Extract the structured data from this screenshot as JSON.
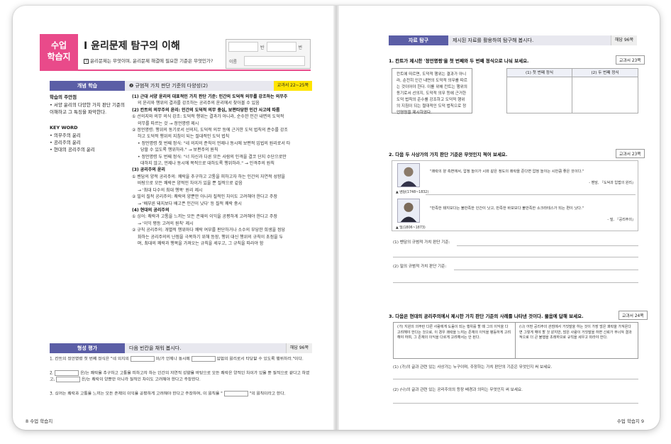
{
  "left": {
    "badge_line1": "수업",
    "badge_line2": "학습지",
    "unit_title": "Ⅰ  윤리문제 탐구의 이해",
    "unit_sub": "윤리문제는 무엇이며, 윤리문제 해결에 필요한 기준은 무엇인가?",
    "name_box": {
      "class_label": "반",
      "number_label": "번",
      "name_label": "이름"
    },
    "concept_bar": {
      "label": "개념 학습",
      "desc": "❷ 규범적 가치 판단 기준의 다양성(2)",
      "tag": "교과서 22~25쪽"
    },
    "sidebar": {
      "goal_heading": "학습의 주안점",
      "goal_text": "• 서양 윤리의 다양한 가치 판단 기준의 이해하고 그 특징을 파악한다.",
      "kw_heading": "KEY WORD",
      "keywords": [
        "의무주의 윤리",
        "공리주의 윤리",
        "현대의 공리주의 윤리"
      ]
    },
    "content": [
      {
        "cls": "h",
        "t": "(1) 근대 서양 윤리의 대표적인 가치 판단 기준: 인간의 도덕적 의무를 강조하는 의무주"
      },
      {
        "cls": "ind",
        "t": "의 윤리와 행위의 결과를 강조하는 공리주의 윤리에서 찾아볼 수 있음"
      },
      {
        "cls": "h",
        "t": "(2) 칸트의 의무주의 윤리: 인간의 도덕적 의무 중심, 보편타당한 인간 사고에 따름"
      },
      {
        "cls": "",
        "t": "① 선의지와 의무 의식 강조: 도덕적 행위는 결과가 아니라, 순수한 인간 내면의 도덕적"
      },
      {
        "cls": "ind",
        "t": "의무를 따르는 것 → 정언명령 제시"
      },
      {
        "cls": "",
        "t": "② 정언명령: 행위의 동기로서 선의지, 도덕적 의무 등에 근거한 도덕 법칙의 준수를 강조"
      },
      {
        "cls": "ind",
        "t": "하고 도덕적 행위의 지침이 되는 절대적인 도덕 법칙"
      },
      {
        "cls": "ind",
        "t": "• 정언명령 첫 번째 정식: \"네 의지의 준칙이 언제나 동시에 보편적 입법의 원리로서 타"
      },
      {
        "cls": "ind2",
        "t": "당할 수 있도록 행위하라.\" → 보편주의 원칙"
      },
      {
        "cls": "ind",
        "t": "• 정언명령 두 번째 정식: \"너 자신과 다른 모든 사람의 인격을 결코 단지 수단으로만"
      },
      {
        "cls": "ind2",
        "t": "대하지 않고, 언제나 동시에 목적으로 대하도록 행위하라.\" → 인격주의 원칙"
      },
      {
        "cls": "h",
        "t": "(3) 공리주의 윤리"
      },
      {
        "cls": "",
        "t": "① 벤담의 양적 공리주의: 쾌락을 추구하고 고통을 피하고자 하는 인간의 자연적 성향을"
      },
      {
        "cls": "ind",
        "t": "바탕으로 모든 쾌락은 양적인 차이가 있을 뿐 질적으로 같음"
      },
      {
        "cls": "ind",
        "t": "→ '최대 다수의 최대 행복' 원리 제시"
      },
      {
        "cls": "",
        "t": "② 밀의 질적 공리주의: 쾌락의 양뿐만 아니라 질적인 차이도 고려해야 한다고 주장"
      },
      {
        "cls": "ind",
        "t": "→ '배부른 돼지보다 배고픈 인간이 낫다' 등 질적 쾌락 중시"
      },
      {
        "cls": "h",
        "t": "(4) 현대의 공리주의"
      },
      {
        "cls": "",
        "t": "① 싱어: 쾌락과 고통을 느끼는 모든 존재의 이익을 공평하게 고려해야 한다고 주장"
      },
      {
        "cls": "ind",
        "t": "→ '이익 평등 고려의 원칙' 제시"
      },
      {
        "cls": "",
        "t": "② 규칙 공리주의: 개별적 행위마다 쾌락 여부를 판단하거나 소수의 부당한 희생을 정당"
      },
      {
        "cls": "ind",
        "t": "화하는 공리주의의 난점을 극복하기 위해 등장, 행위 대신 행위의 규칙이 초점을 두"
      },
      {
        "cls": "ind",
        "t": "며, 최대의 쾌락과 행복을 가져오는 규칙을 세우고, 그 규칙을 따라야 함"
      }
    ],
    "eval_bar": {
      "label": "형성 평가",
      "desc": "다음 빈칸을 채워 봅시다.",
      "tag": "해답 96쪽"
    },
    "eval_items": [
      {
        "n": "1.",
        "a": "칸트의 정언명령 첫 번째 정식은 \"네 의지의",
        "b": "이/가 언제나 동시에",
        "c": "입법의 원리로서 타당할 수 있도록 행위하라.\"이다."
      },
      {
        "n": "2.",
        "a": "",
        "b": "은/는 쾌락을 추구하고 고통을 피하고자 하는 인간의 자연적 성향을 바탕으로 모든 쾌락은 양적인 차이가 있을 뿐 질적으로 같다고 하였고,",
        "c": "은/는 쾌락의 양뿐만 아니라 질적인 차이도 고려해야 한다고 주장한다."
      },
      {
        "n": "3.",
        "a": "싱어는 쾌락과 고통을 느끼는 모든 존재의 이익을 공평하게 고려해야 한다고 주장하며, 이 원칙을 \"",
        "b": "\"의 원칙이라고 한다.",
        "c": ""
      }
    ],
    "footer": "8  수업 학습지"
  },
  "right": {
    "bar": {
      "label": "자료 탐구",
      "desc": "제시된 자료를 활용하여 탐구해 봅시다.",
      "tag": "해답 96쪽"
    },
    "q1": "1. 칸트가 제시한 '정언명령'을 첫 번째와 두 번째 정식으로 나눠 보세요.",
    "q1_ref": "교과서 23쪽",
    "q1_text": "칸트에 따르면, 도덕적 행위는 결과가 아니라, 순전히 인간 내면의 도덕적 의무를 따르는 것이어야 한다. 이를 위해 칸트는 행위의 동기로서 선의지, 도덕적 의무 등에 근거한 도덕 법칙의 준수를 강조하고 도덕적 행위의 지침이 되는 절대적인 도덕 법칙으로 정언명령을 제시하였다.",
    "q1_col1": "(1) 첫 번째 정식",
    "q1_col2": "(2) 두 번째 정식",
    "q2": "2. 다음 두 사상가의 가치 판단 기준은 무엇인지 적어 보세요.",
    "q2_ref": "교과서 23쪽",
    "bentham_cap": "▲ 벤담(1748~1832)",
    "bentham_quote": "\"쾌락의 양 측면에서, 압정 놀이가 시와 같은 정도의 쾌락을 준다면 압정 놀이는 시만큼 좋은 것이다.\"",
    "bentham_src": "- 벤담, 『도덕과 입법의 원리』",
    "mill_cap": "▲ 밀(1806~1873)",
    "mill_quote": "\"만족한 돼지보다는 불만족한 인간이 낫고, 만족한 바보보다 불만족한 소크라테스가 되는 편이 낫다.\"",
    "mill_src": "- 밀, 『공리주의』",
    "q2_a1": "(1) 벤담의 규범적 가치 판단 기준:",
    "q2_a2": "(2) 밀의 규범적 가치 판단 기준:",
    "q3": "3. 다음은 현대의 공리주의에서 제시한 가치 판단 기준의 사례를 나타낸 것이다. 물음에 답해 보세요.",
    "q3_ref": "교과서 24쪽",
    "q3_a": "(가) 지원의 의무란 다른 사람에게 도움이 되는 행위를 할 때 그의 이익을 다 고려해야 한다는 것으로, 이 경우 쾌락을 느끼는 존재의 이익을 평등하게 고려해야 하며, 그 존재의 이익을 다르게 고려해서는 안 된다.",
    "q3_b": "(나) 어떤 공리주의 관점에서 거짓말을 하는 것이 가장 많은 쾌락을 가져온다면 그렇게 해야 할 것 같지만, 많은 사람이 거짓말을 하면 신뢰가 무너져 결과적으로 더 큰 불행을 초래하므로 규칙을 세우고 따라야 한다.",
    "q3_a1": "(1) (가)의 글과 관련 있는 사상가는 누구이며, 주장하는 가치 판단의 기준은 무엇인지 써 보세요.",
    "q3_a2": "(2) (나)의 글과 관련 있는 공리주의의 등장 배경과 의미는 무엇인지 써 보세요.",
    "footer": "수업 학습지  9"
  }
}
